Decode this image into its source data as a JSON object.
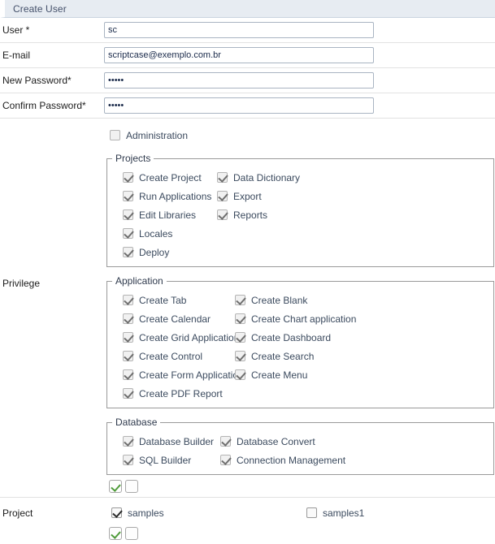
{
  "header": {
    "title": "Create User"
  },
  "fields": {
    "user": {
      "label": "User *",
      "value": "sc"
    },
    "email": {
      "label": "E-mail",
      "value": "scriptcase@exemplo.com.br"
    },
    "newpass": {
      "label": "New Password*",
      "value": "•••••"
    },
    "confirm": {
      "label": "Confirm Password*",
      "value": "•••••"
    }
  },
  "privilege": {
    "label": "Privilege",
    "administration": {
      "label": "Administration",
      "checked": false
    },
    "projects": {
      "legend": "Projects",
      "left": [
        {
          "label": "Create Project",
          "checked": true
        },
        {
          "label": "Run Applications",
          "checked": true
        },
        {
          "label": "Edit Libraries",
          "checked": true
        },
        {
          "label": "Locales",
          "checked": true
        },
        {
          "label": "Deploy",
          "checked": true
        }
      ],
      "right": [
        {
          "label": "Data Dictionary",
          "checked": true
        },
        {
          "label": "Export",
          "checked": true
        },
        {
          "label": "Reports",
          "checked": true
        }
      ]
    },
    "application": {
      "legend": "Application",
      "left": [
        {
          "label": "Create Tab",
          "checked": true
        },
        {
          "label": "Create Calendar",
          "checked": true
        },
        {
          "label": "Create Grid Application",
          "checked": true
        },
        {
          "label": "Create Control",
          "checked": true
        },
        {
          "label": "Create Form Application",
          "checked": true
        },
        {
          "label": "Create PDF Report",
          "checked": true
        }
      ],
      "right": [
        {
          "label": "Create Blank",
          "checked": true
        },
        {
          "label": "Create Chart application",
          "checked": true
        },
        {
          "label": "Create Dashboard",
          "checked": true
        },
        {
          "label": "Create Search",
          "checked": true
        },
        {
          "label": "Create Menu",
          "checked": true
        }
      ]
    },
    "database": {
      "legend": "Database",
      "left": [
        {
          "label": "Database Builder",
          "checked": true
        },
        {
          "label": "SQL Builder",
          "checked": true
        }
      ],
      "right": [
        {
          "label": "Database Convert",
          "checked": true
        },
        {
          "label": "Connection Management",
          "checked": true
        }
      ]
    },
    "bulk": {
      "check_all": "check-all",
      "uncheck_all": "uncheck-all"
    }
  },
  "project": {
    "label": "Project",
    "items": [
      {
        "label": "samples",
        "checked": true
      },
      {
        "label": "samples1",
        "checked": false
      }
    ],
    "bulk": {
      "check_all": "check-all",
      "uncheck_all": "uncheck-all"
    }
  },
  "colors": {
    "header_bg": "#e7ecf2",
    "header_text": "#44506a",
    "row_divider": "#e2e2e2",
    "input_border": "#a9b4c2",
    "check_green": "#4f9b3a"
  }
}
